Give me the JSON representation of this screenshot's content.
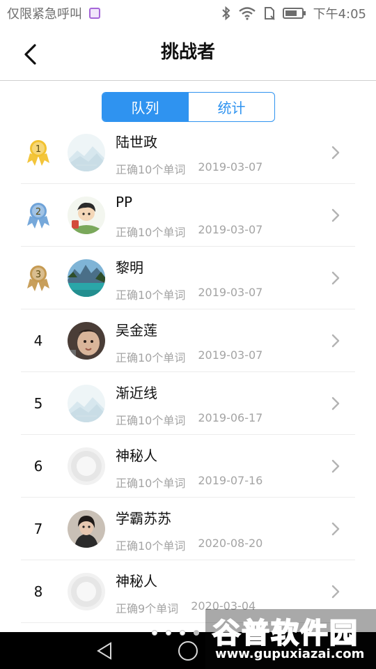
{
  "status_bar": {
    "left_text": "仅限紧急呼叫",
    "time": "下午4:05"
  },
  "header": {
    "title": "挑战者"
  },
  "tabs": [
    {
      "label": "队列",
      "active": true
    },
    {
      "label": "统计",
      "active": false
    }
  ],
  "rows": [
    {
      "rank": "1",
      "name": "陆世政",
      "detail": "正确10个单词",
      "date": "2019-03-07",
      "rank_icon": "gold-medal-icon",
      "avatar": "landscape-placeholder-avatar"
    },
    {
      "rank": "2",
      "name": "PP",
      "detail": "正确10个单词",
      "date": "2019-03-07",
      "rank_icon": "silver-medal-icon",
      "avatar": "cartoon-avatar"
    },
    {
      "rank": "3",
      "name": "黎明",
      "detail": "正确10个单词",
      "date": "2019-03-07",
      "rank_icon": "bronze-medal-icon",
      "avatar": "lake-photo-avatar"
    },
    {
      "rank": "4",
      "name": "吴金莲",
      "detail": "正确10个单词",
      "date": "2019-03-07",
      "avatar": "child-photo-avatar"
    },
    {
      "rank": "5",
      "name": "渐近线",
      "detail": "正确10个单词",
      "date": "2019-06-17",
      "avatar": "landscape-placeholder-avatar"
    },
    {
      "rank": "6",
      "name": "神秘人",
      "detail": "正确10个单词",
      "date": "2019-07-16",
      "avatar": "default-person-avatar"
    },
    {
      "rank": "7",
      "name": "学霸苏苏",
      "detail": "正确10个单词",
      "date": "2020-08-20",
      "avatar": "woman-photo-avatar"
    },
    {
      "rank": "8",
      "name": "神秘人",
      "detail": "正确9个单词",
      "date": "2020-03-04",
      "avatar": "default-person-avatar"
    }
  ],
  "colors": {
    "accent": "#2f93f0",
    "gold": "#f2c230",
    "silver": "#6fa3d8",
    "bronze": "#c59a52"
  },
  "watermark": {
    "title": "谷普软件园",
    "url": "www.gupuxiazai.com"
  }
}
